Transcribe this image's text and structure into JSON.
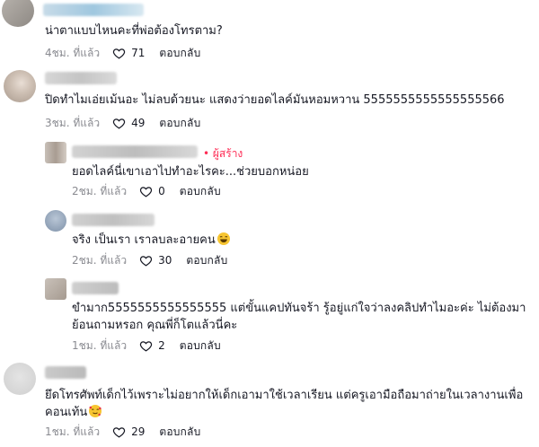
{
  "comments": [
    {
      "text": "น่าตาแบบไหนคะที่พ่อต้องโทรตาม?",
      "time": "4ชม. ที่แล้ว",
      "likes": "71",
      "reply_label": "ตอบกลับ"
    },
    {
      "text": "ปิดทำไมเอ่ยเม้นอะ ไม่ลบด้วยนะ แสดงว่ายอดไลค์มันหอมหวาน 5555555555555555566",
      "time": "3ชม. ที่แล้ว",
      "likes": "49",
      "reply_label": "ตอบกลับ"
    },
    {
      "creator_badge": "• ผู้สร้าง",
      "text": "ยอดไลค์นี่เขาเอาไปทำอะไรคะ...ช่วยบอกหน่อย",
      "time": "2ชม. ที่แล้ว",
      "likes": "0",
      "reply_label": "ตอบกลับ"
    },
    {
      "text": "จริง เป็นเรา เราลบละอายคน",
      "time": "2ชม. ที่แล้ว",
      "likes": "30",
      "reply_label": "ตอบกลับ"
    },
    {
      "text_line1": "ขำมาก5555555555555555 แต่ขั้นแคปทันจร้า รู้อยู่แก่ใจว่าลงคลิปทำไมอะค่ะ ไม่ต้องมา",
      "text_line2": "ย้อนถามหรอก คุณพี่ก็โตแล้วนี่คะ",
      "time": "1ชม. ที่แล้ว",
      "likes": "2",
      "reply_label": "ตอบกลับ"
    },
    {
      "text_line1": "ยึดโทรศัพท์เด็กไว้เพราะไม่อยากให้เด็กเอามาใช้เวลาเรียน แต่ครูเอามือถือมาถ่ายในเวลางานเพื่อ",
      "text_line2": "คอนเท้น",
      "time": "1ชม. ที่แล้ว",
      "likes": "29",
      "reply_label": "ตอบกลับ"
    }
  ],
  "colors": {
    "creator": "#fe2c55",
    "meta": "#8a8b91",
    "text": "#161823"
  }
}
